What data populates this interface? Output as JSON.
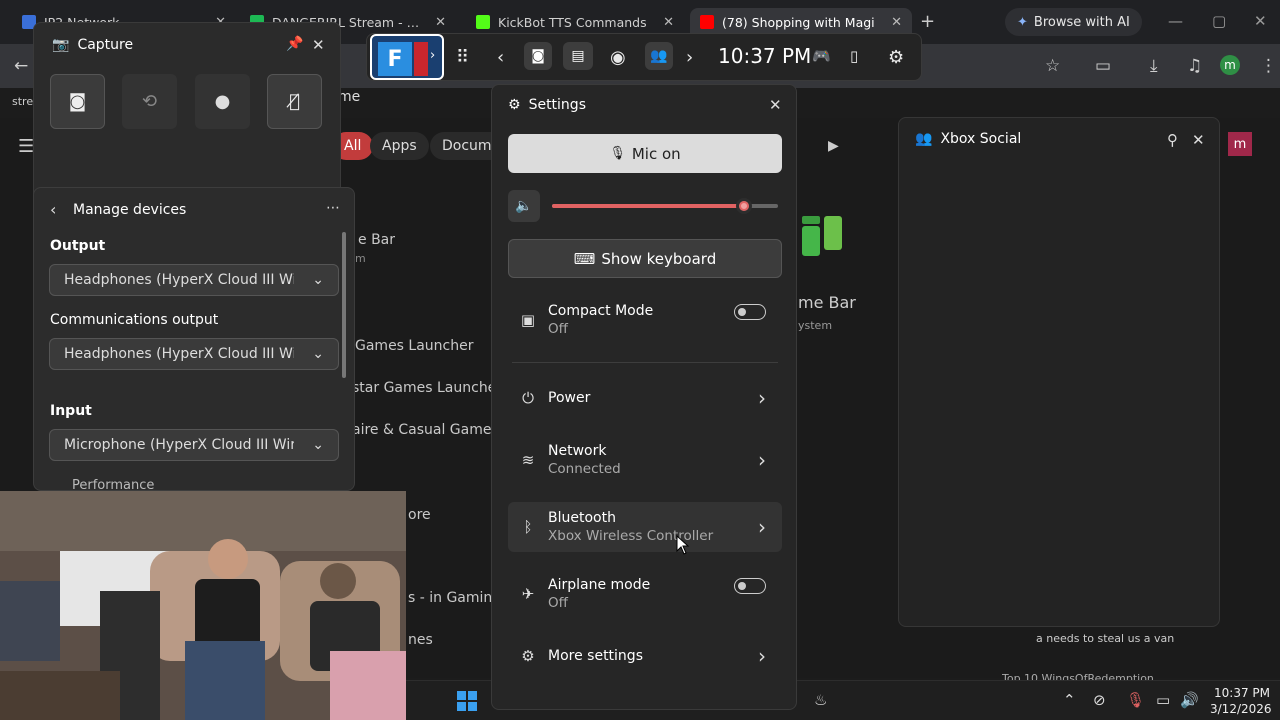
{
  "browser": {
    "tabs": [
      {
        "title": "IP2 Network",
        "active": false,
        "color": "#3a6fd8"
      },
      {
        "title": "DANGERIRL Stream - Watch",
        "active": false,
        "color": "#1db954"
      },
      {
        "title": "KickBot TTS Commands",
        "active": false,
        "color": "#53fc18"
      },
      {
        "title": "(78) Shopping with Magi",
        "active": true,
        "color": "#ff0000"
      }
    ],
    "new_tab": "+",
    "browse_ai": "Browse with AI",
    "profile_initial": "m",
    "bookmark_stub": "stre",
    "address_stub": "me"
  },
  "page": {
    "chips": [
      "All",
      "Apps",
      "Docume"
    ],
    "list": [
      "h",
      "e Bar",
      "m",
      "Games Launcher",
      "star Games Launcher",
      "aire & Casual Games",
      "ore",
      "s - in Gaming PC",
      "nes"
    ],
    "tile_title": "me Bar",
    "tile_sub": "ystem",
    "chat_line": "a needs to steal us a van",
    "chat_line2": "Top 10 WingsOfRedemption"
  },
  "capture": {
    "title": "Capture",
    "buttons": [
      "screenshot",
      "record-last",
      "record",
      "mic-muted"
    ]
  },
  "devices": {
    "title": "Manage devices",
    "output_label": "Output",
    "output_value": "Headphones (HyperX Cloud III Wireless)",
    "comm_label": "Communications output",
    "comm_value": "Headphones (HyperX Cloud III Wireless)",
    "input_label": "Input",
    "input_value": "Microphone (HyperX Cloud III Wireless)",
    "next_widget": "Performance"
  },
  "gamebar": {
    "time": "10:37 PM"
  },
  "settings": {
    "title": "Settings",
    "mic_label": "Mic on",
    "volume_fraction": 0.85,
    "keyboard_label": "Show keyboard",
    "compact": {
      "label": "Compact Mode",
      "state": "Off"
    },
    "power": {
      "label": "Power"
    },
    "network": {
      "label": "Network",
      "state": "Connected"
    },
    "bluetooth": {
      "label": "Bluetooth",
      "state": "Xbox Wireless Controller"
    },
    "airplane": {
      "label": "Airplane mode",
      "state": "Off"
    },
    "more": {
      "label": "More settings"
    }
  },
  "social": {
    "title": "Xbox Social"
  },
  "taskbar": {
    "time": "10:37 PM",
    "date": "3/12/2026"
  },
  "colors": {
    "accent_red": "#e06262",
    "chip_red": "#c23c3c"
  }
}
